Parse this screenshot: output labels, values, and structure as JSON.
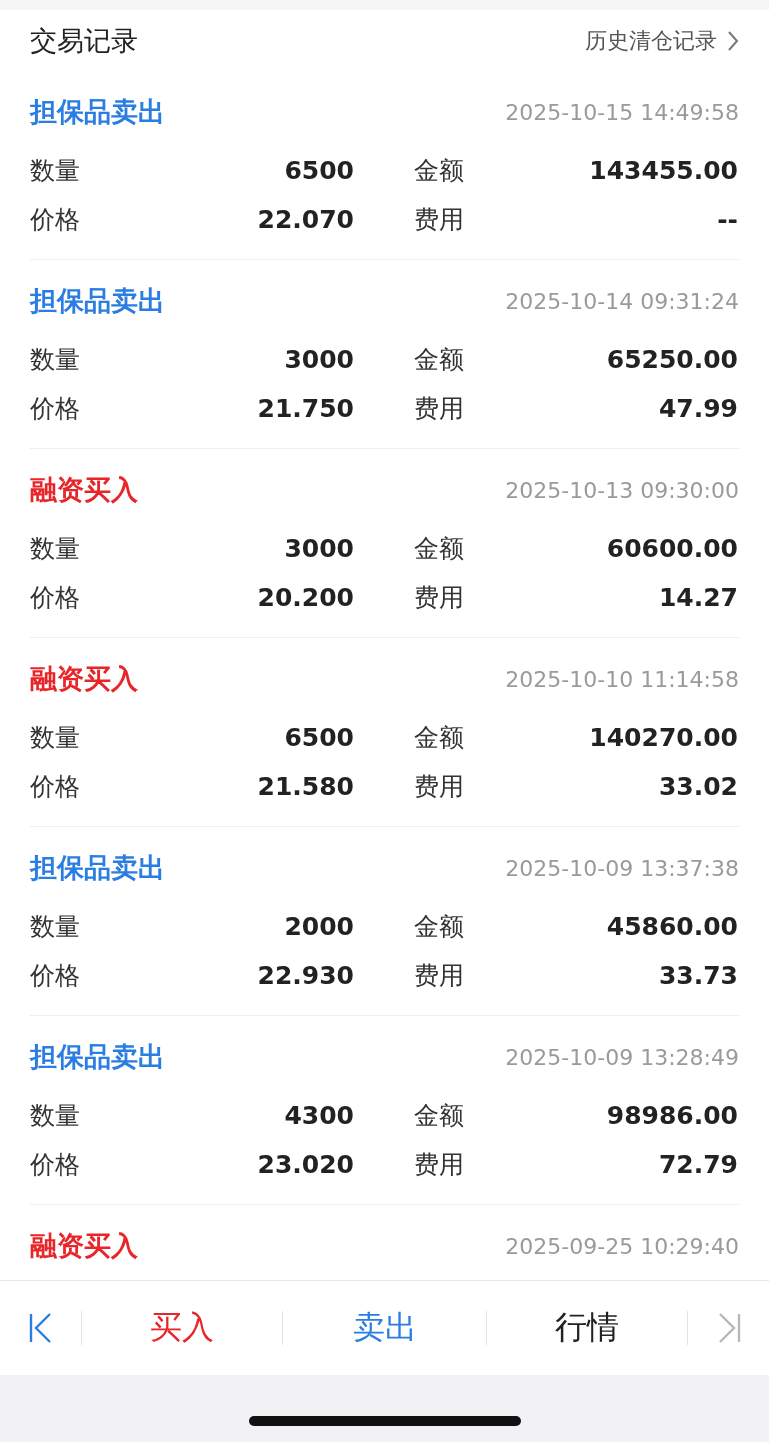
{
  "header": {
    "title": "交易记录",
    "link": "历史清仓记录"
  },
  "records": [
    {
      "kind": "sell",
      "title": "担保品卖出",
      "time": "2025-10-15 14:49:58",
      "fields": [
        {
          "label": "数量",
          "value": "6500"
        },
        {
          "label": "金额",
          "value": "143455.00"
        },
        {
          "label": "价格",
          "value": "22.070"
        },
        {
          "label": "费用",
          "value": "--"
        }
      ]
    },
    {
      "kind": "sell",
      "title": "担保品卖出",
      "time": "2025-10-14 09:31:24",
      "fields": [
        {
          "label": "数量",
          "value": "3000"
        },
        {
          "label": "金额",
          "value": "65250.00"
        },
        {
          "label": "价格",
          "value": "21.750"
        },
        {
          "label": "费用",
          "value": "47.99"
        }
      ]
    },
    {
      "kind": "buy",
      "title": "融资买入",
      "time": "2025-10-13 09:30:00",
      "fields": [
        {
          "label": "数量",
          "value": "3000"
        },
        {
          "label": "金额",
          "value": "60600.00"
        },
        {
          "label": "价格",
          "value": "20.200"
        },
        {
          "label": "费用",
          "value": "14.27"
        }
      ]
    },
    {
      "kind": "buy",
      "title": "融资买入",
      "time": "2025-10-10 11:14:58",
      "fields": [
        {
          "label": "数量",
          "value": "6500"
        },
        {
          "label": "金额",
          "value": "140270.00"
        },
        {
          "label": "价格",
          "value": "21.580"
        },
        {
          "label": "费用",
          "value": "33.02"
        }
      ]
    },
    {
      "kind": "sell",
      "title": "担保品卖出",
      "time": "2025-10-09 13:37:38",
      "fields": [
        {
          "label": "数量",
          "value": "2000"
        },
        {
          "label": "金额",
          "value": "45860.00"
        },
        {
          "label": "价格",
          "value": "22.930"
        },
        {
          "label": "费用",
          "value": "33.73"
        }
      ]
    },
    {
      "kind": "sell",
      "title": "担保品卖出",
      "time": "2025-10-09 13:28:49",
      "fields": [
        {
          "label": "数量",
          "value": "4300"
        },
        {
          "label": "金额",
          "value": "98986.00"
        },
        {
          "label": "价格",
          "value": "23.020"
        },
        {
          "label": "费用",
          "value": "72.79"
        }
      ]
    },
    {
      "kind": "buy",
      "title": "融资买入",
      "time": "2025-09-25 10:29:40"
    }
  ],
  "nav": [
    {
      "kind": "first",
      "disabled": false
    },
    {
      "kind": "text",
      "label": "买入",
      "color": "#e8262a"
    },
    {
      "kind": "text",
      "label": "卖出",
      "color": "#2a7de1"
    },
    {
      "kind": "text",
      "label": "行情",
      "color": "#222222"
    },
    {
      "kind": "last",
      "disabled": true
    }
  ]
}
